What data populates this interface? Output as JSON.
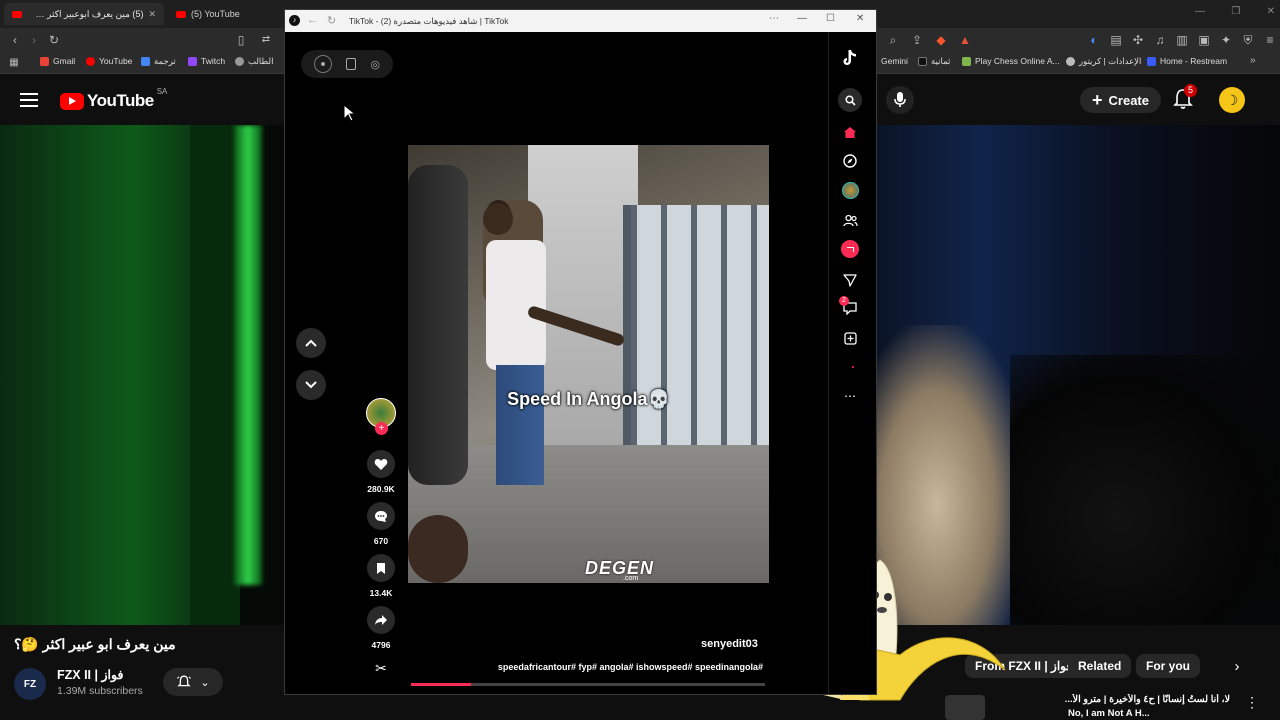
{
  "browser": {
    "tabs": [
      {
        "title": "(5) مين يعرف ابوعبير اكثر 🤔؟ - ...",
        "active": true
      },
      {
        "title": "(5) YouTube",
        "active": false
      }
    ],
    "bookmarks": [
      "Gmail",
      "YouTube",
      "ترجمة",
      "Twitch",
      "الطالب"
    ],
    "bookmarks_right": [
      "Gemini",
      "ثمانية",
      "Play Chess Online A...",
      "الإعدادات | كريتور",
      "Home - Restream"
    ],
    "colors": {
      "accent": "#ff0000",
      "chrome_bg": "#2b2b2b"
    }
  },
  "youtube": {
    "logo_text": "YouTube",
    "region": "SA",
    "create_label": "Create",
    "notification_count": "5",
    "video_title": "مين يعرف ابو عبير اكثر 🤔؟",
    "channel_name": "FZX II | فواز",
    "subscribers": "1.39M subscribers",
    "chips": [
      "From FZX II | فواز",
      "Related",
      "For you"
    ],
    "next_video_title": "لا، أنا لستُ إنسانًا | ح٤ والأخيرة | مترو الأ...",
    "next_video_title_en": "No, I am Not A H..."
  },
  "tiktok": {
    "window_title": "TikTok - (2) شاهد فيديوهات متصدرة | TikTok",
    "caption_overlay": "Speed In Angola💀",
    "watermark": "DEGEN",
    "watermark_sub": ".com",
    "author": "senyedit03",
    "hashtags": "speedafricantour# fyp# angola# ishowspeed# speedinangola#",
    "likes": "280.9K",
    "comments": "670",
    "saves": "13.4K",
    "shares": "4796",
    "progress": 0.17,
    "inbox_badge": "2"
  }
}
